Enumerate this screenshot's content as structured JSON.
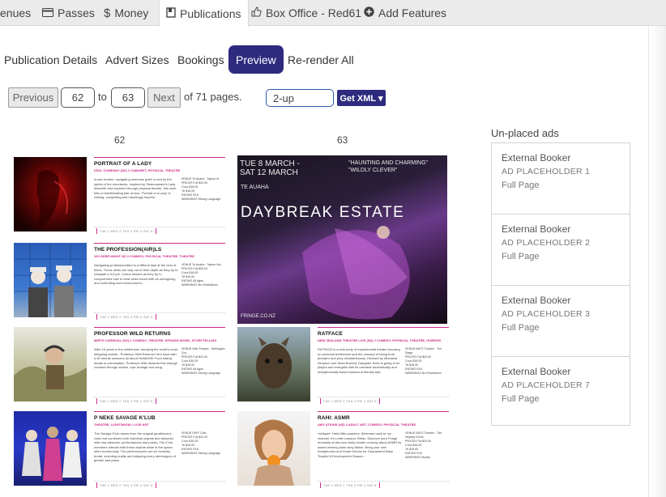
{
  "topnav": {
    "items": [
      {
        "label": "enues",
        "icon": "none"
      },
      {
        "label": "Passes",
        "icon": "card-icon"
      },
      {
        "label": "Money",
        "icon": "dollar-icon"
      },
      {
        "label": "Publications",
        "icon": "book-icon"
      },
      {
        "label": "Box Office - Red61",
        "icon": "thumb-up-icon"
      },
      {
        "label": "Add Features",
        "icon": "plus-circle-icon"
      }
    ],
    "active": "Publications"
  },
  "subtabs": {
    "items": [
      "Publication Details",
      "Advert Sizes",
      "Bookings",
      "Preview",
      "Re-render All"
    ],
    "active": "Preview"
  },
  "pager": {
    "previous": "Previous",
    "from": "62",
    "to_label": "to",
    "to": "63",
    "next": "Next",
    "of_text": "of 71 pages.",
    "layout": "2-up",
    "get_xml": "Get XML ▾"
  },
  "pages": {
    "left_number": "62",
    "right_number": "63"
  },
  "listings": [
    {
      "title": "PORTRAIT OF A LADY",
      "subtitle": "KR1L COMPANY (NZ) // CABARET, PHYSICAL THEATRE",
      "desc": "A new mother, navigating immense grief, is met by the spirits of the moorlands. Inspired by Shakespeare's Lady Macbeth and explored through physical theatre, this work tells a heartbreaking tale of loss. 'Portrait of a Lady' is chilling, compelling and hauntingly hopeful.",
      "meta": "VENUE  Te Auaha - Tapere Iti\nPRICES  Full $20.00\nConc $16.00\nTA $16.00\nRATING  R16\nWARNINGS  Strong Language",
      "dates": "TUE 1  WED 2  THU 3  FRI 4  SAT 5"
    },
    {
      "title": "THE PROFESSION(AIR)LS",
      "subtitle": "100 GREE MIGHT NZ // COMEDY, PHYSICAL THEATRE, THEATRE",
      "desc": "Navigating professionalism is a difficult task at the best of times. These idiots are way out of their depth as they try to navigate a 9-5 job. Chaos ensues as they try to comprehend how to exist when faced with an unforgiving and controlling work environment...",
      "meta": "VENUE  Te Auaha - Tapere Nui\nPRICES  Full $20.00\nConc $16.00\nTA $16.00\nRATING  All Ages\nWARNINGS  No Restrictions",
      "dates": "TUE 1  WED 2  THU 3  FRI 4  SAT 5"
    },
    {
      "title": "PROFESSOR WILD RETURNS",
      "subtitle": "MIRTH CARNIVAL (NZ) // COMEDY, THEATRE, SPOKEN WORD, STORYTELLING",
      "desc": "After 15 years in the wilderness, studying the world's most intriguing animal - Professor Wild Returns! He's back with a 50 minute sessions all about HUMANS! From eating rituals to colonisation, Professor Wild dissects this strange creature through stories, epic footage and song.",
      "meta": "VENUE  Wild Theatre - Wellington Zoo\nPRICES  Full $22.00\nConc $16.00\nTA $16.00\nRATING  All Ages\nWARNINGS  Strong Language",
      "dates": "TUE 1  WED 2  THU 3  FRI 4  SAT 5"
    },
    {
      "title": "RATFACE",
      "subtitle": "NEW ZEALAND THEATRE LIVE (NZ) // COMEDY, PHYSICAL THEATRE, HORROR",
      "desc": "RATFACE is a solo body of experimental theatre focusing on personal betterment and the concept of being both predator and prey simultaneously. Devised by Michaela Simpson and Sean Burnett. Daughter Rat's is going to be playful and energetic with its narrative aesthetically and metaphorically based instead of literally tied.",
      "meta": "VENUE  BATS Theatre - The Stage\nPRICES  Full $20.00\nConc $16.00\nTA $16.00\nRATING  R16\nWARNINGS  No Restrictions",
      "dates": "TUE 1  WED 2  THU 3  FRI 4  SAT 5"
    },
    {
      "title": "P NEKE SAVAGE K'LUB",
      "subtitle": "THEATRE, LIGHTSHOW // LIVE ART",
      "desc": "The Savage K'lub draws from the original gentleman's clubs but combines both historical objects and artworks with new artworks, performances and poetry. The K'lub members interact with these objects while in the space, often humorously. The performances can be honestly brutal, including nudity and stripping every stereotypes of gender and place.",
      "meta": "VENUE  FAFF Club\nPRICES  Full $22.00\nConc $16.00\nTA $16.00\nRATING  R16\nWARNINGS  Strong Language",
      "dates": "TUE 1  WED 2  THU 3  FRI 4  SAT 5"
    },
    {
      "title": "RAHI: ASMR",
      "subtitle": "AMY ATKINS (NZ) // ADULT ART, COMEDY, PHYSICAL THEATRE",
      "desc": "*whisper* Hello little peaches. Welcome back to my channel, it's Lottie Lawson. Relax. Discover your Fringe Immunity at this new fruity bundle comedy about ASMR by award winning actor Amy Atkins. Bring your own headphones and Smart Device for Guaranteed Base Tingles! A Development Season.",
      "meta": "VENUE  BATS Theatre - The Heyday Dome\nPRICES  Full $20.00\nConc $16.00\nTA $16.00\nRATING  R16\nWARNINGS  Nudity",
      "dates": "TUE 1  WED 2  THU 3  FRI 4  SAT 5"
    }
  ],
  "daybreak_ad": {
    "dates": "TUE 8 MARCH -\nSAT 12 MARCH",
    "quote": "\"HAUNTING AND CHARMING\"\n\"WILDLY CLEVER\"",
    "venue": "TE AUAHA",
    "title": "DAYBREAK ESTATE",
    "url": "FRINGE.CO.NZ"
  },
  "unplaced": {
    "heading": "Un-placed ads",
    "ads": [
      {
        "booker": "External Booker",
        "name": "AD PLACEHOLDER 1",
        "size": "Full Page"
      },
      {
        "booker": "External Booker",
        "name": "AD PLACEHOLDER 2",
        "size": "Full Page"
      },
      {
        "booker": "External Booker",
        "name": "AD PLACEHOLDER 3",
        "size": "Full Page"
      },
      {
        "booker": "External Booker",
        "name": "AD PLACEHOLDER 7",
        "size": "Full Page"
      }
    ]
  },
  "colors": {
    "accent": "#2e2a7e",
    "listing_pink": "#cc2a8a"
  }
}
